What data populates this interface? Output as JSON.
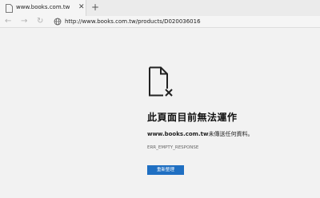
{
  "tab": {
    "title": "www.books.com.tw",
    "close_glyph": "✕",
    "new_tab_glyph": "+"
  },
  "toolbar": {
    "back_glyph": "←",
    "forward_glyph": "→",
    "reload_glyph": "↻",
    "url": "http://www.books.com.tw/products/D020036016"
  },
  "error": {
    "icon": "document-error-icon",
    "title": "此頁面目前無法運作",
    "host": "www.books.com.tw",
    "message": "未傳送任何資料。",
    "code": "ERR_EMPTY_RESPONSE",
    "reload_label": "重新整理"
  },
  "colors": {
    "button": "#1f6fc2",
    "background": "#f2f2f2"
  }
}
